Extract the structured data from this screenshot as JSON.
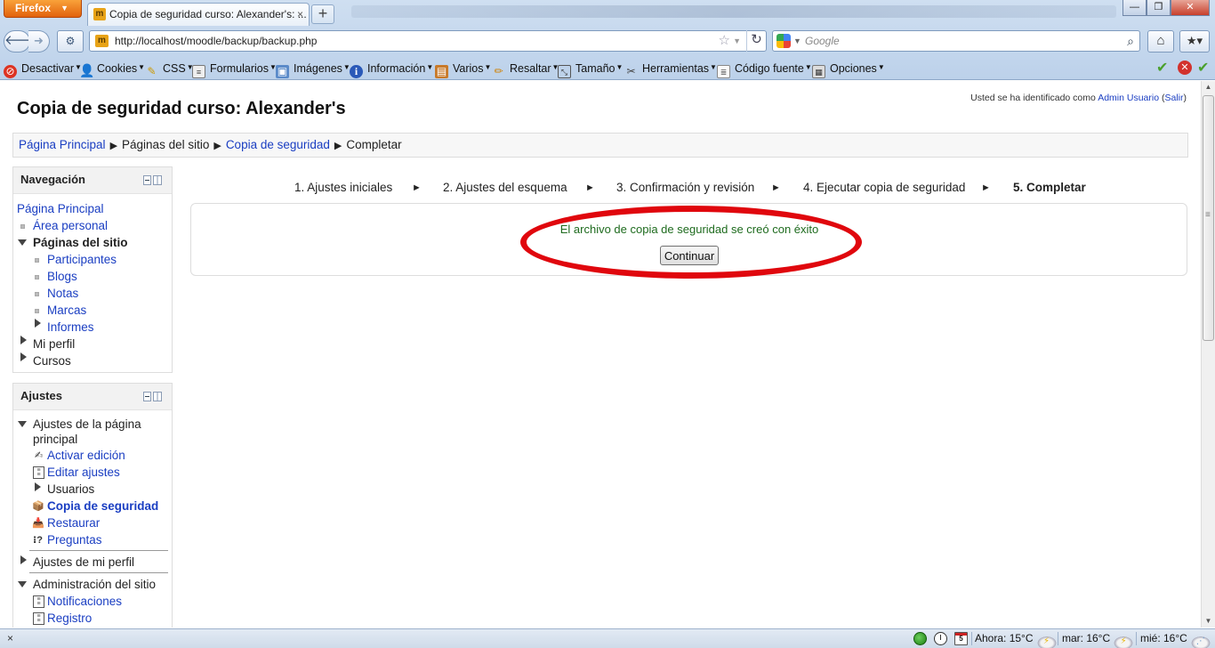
{
  "browser": {
    "menu_button": "Firefox",
    "tab_title": "Copia de seguridad curso: Alexander's: ...",
    "new_tab": "+",
    "url": "http://localhost/moodle/backup/backup.php",
    "search_placeholder": "Google",
    "toolbar": [
      {
        "label": "Desactivar",
        "icon": "disable-icon"
      },
      {
        "label": "Cookies",
        "icon": "user-icon"
      },
      {
        "label": "CSS",
        "icon": "pencil-icon"
      },
      {
        "label": "Formularios",
        "icon": "form-icon"
      },
      {
        "label": "Imágenes",
        "icon": "image-icon"
      },
      {
        "label": "Información",
        "icon": "info-icon"
      },
      {
        "label": "Varios",
        "icon": "misc-icon"
      },
      {
        "label": "Resaltar",
        "icon": "highlight-icon"
      },
      {
        "label": "Tamaño",
        "icon": "resize-icon"
      },
      {
        "label": "Herramientas",
        "icon": "tools-icon"
      },
      {
        "label": "Código fuente",
        "icon": "source-icon"
      },
      {
        "label": "Opciones",
        "icon": "options-icon"
      }
    ]
  },
  "page": {
    "title": "Copia de seguridad curso: Alexander's",
    "login": {
      "prefix": "Usted se ha identificado como ",
      "user": "Admin Usuario",
      "logout": "Salir"
    },
    "breadcrumb": [
      "Página Principal",
      "Páginas del sitio",
      "Copia de seguridad",
      "Completar"
    ],
    "navigation": {
      "title": "Navegación",
      "home": "Página Principal",
      "personal": "Área personal",
      "site_pages": "Páginas del sitio",
      "participants": "Participantes",
      "blogs": "Blogs",
      "notes": "Notas",
      "tags": "Marcas",
      "reports": "Informes",
      "profile": "Mi perfil",
      "courses": "Cursos"
    },
    "settings": {
      "title": "Ajustes",
      "front_page_line1": "Ajustes de la página",
      "front_page_line2": "principal",
      "edit_mode": "Activar edición",
      "edit_settings": "Editar ajustes",
      "users": "Usuarios",
      "backup": "Copia de seguridad",
      "restore": "Restaurar",
      "questions": "Preguntas",
      "my_profile": "Ajustes de mi perfil",
      "site_admin": "Administración del sitio",
      "notifications": "Notificaciones",
      "registration": "Registro"
    },
    "steps": [
      "1. Ajustes iniciales",
      "2. Ajustes del esquema",
      "3. Confirmación y revisión",
      "4. Ejecutar copia de seguridad",
      "5. Completar"
    ],
    "step_separator": "►",
    "success_message": "El archivo de copia de seguridad se creó con éxito",
    "continue_button": "Continuar"
  },
  "statusbar": {
    "close": "×",
    "calendar_day": "5",
    "weather": [
      "Ahora: 15°C",
      "mar: 16°C",
      "mié: 16°C"
    ]
  },
  "colors": {
    "link": "#1a3ec2",
    "success_text": "#1e6b1e",
    "annotation_ellipse": "#e0070d"
  }
}
